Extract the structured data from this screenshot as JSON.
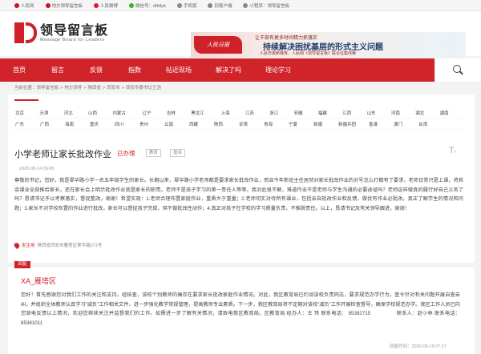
{
  "topbar": [
    {
      "label": "人民网",
      "color": "#c4161c"
    },
    {
      "label": "地方领导留言板",
      "color": "#c4161c"
    },
    {
      "label": "人民微博",
      "color": "#e6162d"
    },
    {
      "label": "微信号：dfldlyb",
      "color": "#3cb034"
    },
    {
      "label": "手机版",
      "color": "#888888"
    },
    {
      "label": "别客户端",
      "color": "#888888"
    },
    {
      "label": "小程序：领导留言板",
      "color": "#888888"
    }
  ],
  "logo": {
    "cn": "领导留言板",
    "en": "Message Board for Leaders"
  },
  "banner": {
    "badge": "人民日报",
    "line1": "让干部有更多时间精力抓落实",
    "line2": "持续解决困扰基层的形式主义问题",
    "line3": "人民日报新媒体、人民网《领导留言板》联合征集线索"
  },
  "nav": [
    {
      "label": "首页",
      "w": 48
    },
    {
      "label": "留言",
      "w": 48
    },
    {
      "label": "反馈",
      "w": 48
    },
    {
      "label": "指数",
      "w": 48
    },
    {
      "label": "帖近现场",
      "w": 62
    },
    {
      "label": "解决了吗",
      "w": 62
    },
    {
      "label": "理论学习",
      "w": 62
    }
  ],
  "breadcrumb": [
    "当前位置：",
    "领导留言板",
    "地方领导",
    "陕西省",
    "西安市",
    "西安市委书记王浩"
  ],
  "regions": [
    [
      "北京",
      "天津",
      "河北",
      "山西",
      "内蒙古",
      "辽宁",
      "吉林",
      "黑龙江",
      "上海",
      "江苏",
      "浙江",
      "安徽",
      "福建",
      "江西",
      "山东",
      "河南",
      "湖北",
      "湖南"
    ],
    [
      "广东",
      "广西",
      "海南",
      "重庆",
      "四川",
      "贵州",
      "云南",
      "西藏",
      "陕西",
      "甘肃",
      "青海",
      "宁夏",
      "新疆",
      "新疆兵团",
      "香港",
      "澳门",
      "台湾"
    ]
  ],
  "post": {
    "title": "小学老师让家长批改作业",
    "state": "已办理",
    "tags": [
      "教育",
      "投诉"
    ],
    "time": "2020-09-14 09:45",
    "body": "尊敬的书记，您好。我是翠华路小学一名五年级学生的家长。长期以来，翠华路小学老师都是要求家长批改作业，而且今年新班主任居然对家长批改作业的对号怎么打都有了要求，老师日常只是上课，将其余课业全部推给家长，还在家长会上明示批改作业就是家长的职责。老师不是孩子学习的第一责任人等等。我对此很不解，难道作业不是老师与学生沟通的必要途径吗？老师这样做真的履行好自己义务了吗？恳请书记予以考察落实，督促整改，谢谢！希望实现：1.老师合理布置家庭作业，重质大于重量；2.老师切实对待所有课业，包括亲自批改作业和反馈，做优有作业必批改，真正了解学生的情况和问题；3.家长不对学校布置的作业进行批改，家长可以督促孩子完成，但不做批改性动作；4.真正对孩子在学校的学习质量负责，不推脱责任。以上，恳请书记及有关领导跟进，谢谢！",
    "location_label": "发生地",
    "location": "陕西省西安市雁塔区翠华路371号"
  },
  "reply": {
    "badge": "回复",
    "author": "XA_雁塔区",
    "body": "您好！首先感谢您对我们工作的关注和支持。经核查，该校个别教师的确存在要求家长批改家庭作业情况。对此，我区教育局已约谈该校负责同志，要求规范办学行为，医令针对有关问题开展自查自纠，并组织全体教师认真学习“减负”工作相关文件，进一步强化教学常规管理，提高教师专业素质。下一步，我区教育局将不定期对该校“减负”工作开展检查督导，确保学校规范办学。我区工作人员已向您致电反馈以上情况，欢迎您继续关注并监督我们的工作。如需进一步了解有关情况，请致电我区教育局。区教育局 经办人：王 玮 联系电话： 85382715　　　　　联系人：赵小林 联系电话：85381011",
    "time": "回复时间：2020-09-19 07:17"
  }
}
